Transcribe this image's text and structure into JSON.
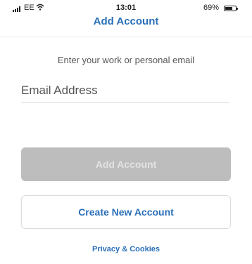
{
  "status_bar": {
    "carrier": "EE",
    "time": "13:01",
    "battery_percent": "69%",
    "battery_level": 0.69,
    "signal_icon": "signal-bars-icon",
    "wifi_icon": "wifi-icon",
    "battery_icon": "battery-icon"
  },
  "header": {
    "title": "Add Account"
  },
  "main": {
    "prompt": "Enter your work or personal email",
    "email_placeholder": "Email Address",
    "email_value": "",
    "add_account_label": "Add Account",
    "create_account_label": "Create New Account",
    "privacy_label": "Privacy & Cookies"
  },
  "colors": {
    "accent": "#2a6fb8",
    "disabled_button": "#bdbdbd",
    "disabled_text": "#e2e2e2",
    "border": "#dcdcdc"
  }
}
